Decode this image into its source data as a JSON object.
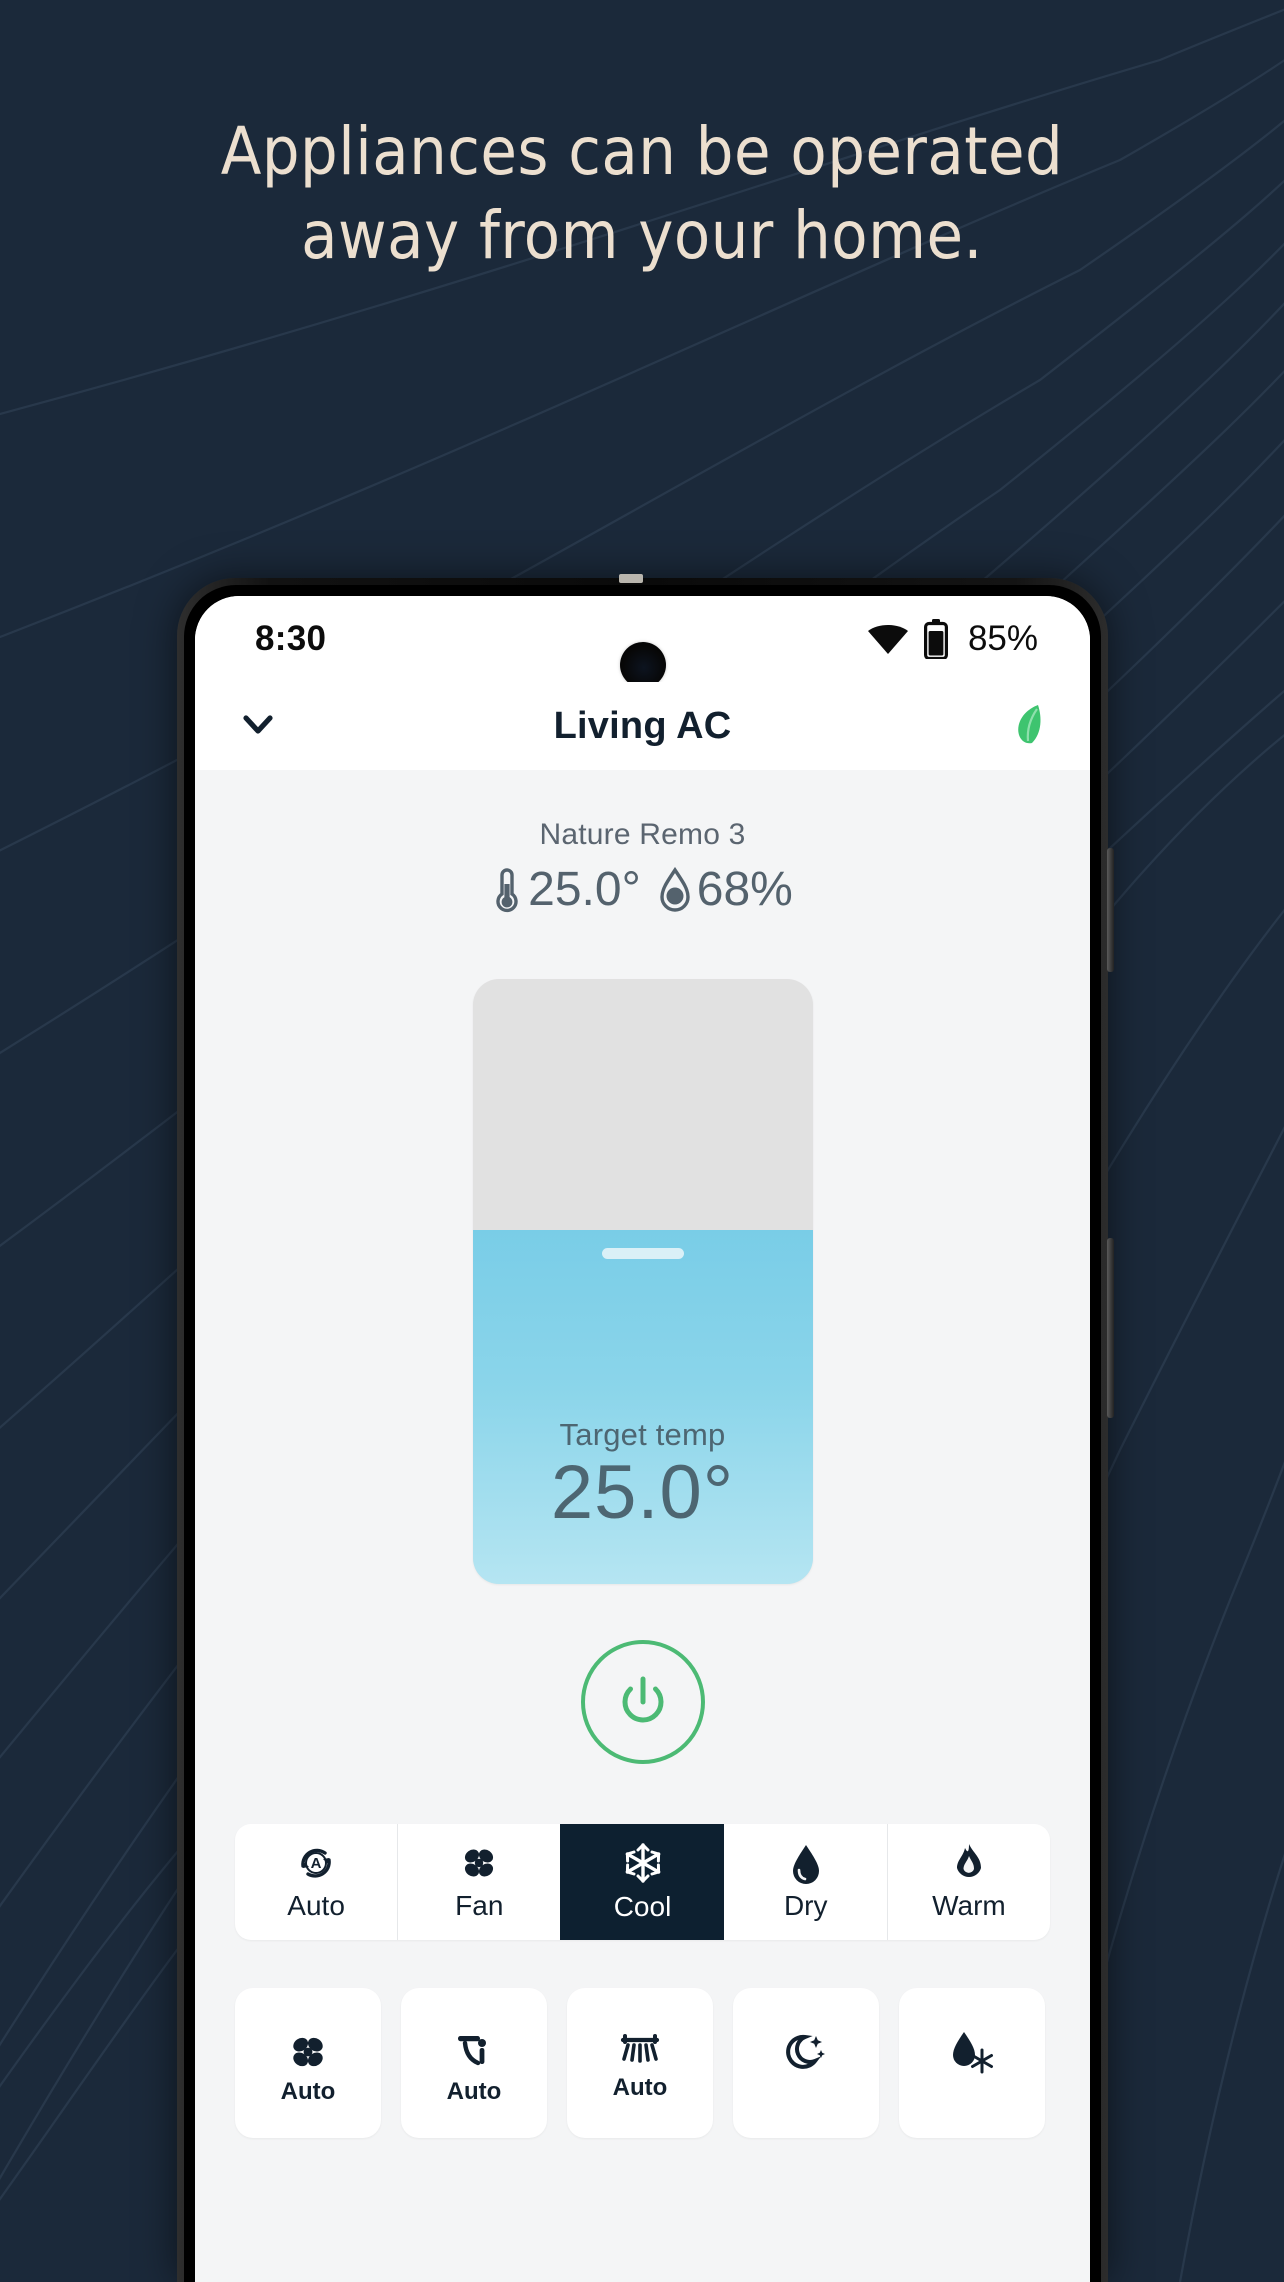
{
  "page": {
    "background_color": "#1b293a",
    "headline_color": "#ecdfcf",
    "headline_line1": "Appliances can be operated",
    "headline_line2": "away from your home."
  },
  "phone": {
    "statusbar": {
      "time": "8:30",
      "wifi_icon": "wifi-icon",
      "battery_icon": "battery-icon",
      "battery_percent": "85%",
      "camera_icon": "front-camera-punch-hole"
    },
    "header": {
      "back_icon": "chevron-down-icon",
      "title": "Living AC",
      "eco_icon": "leaf-icon",
      "eco_color": "#3ec46f"
    },
    "sensor": {
      "device_name": "Nature Remo 3",
      "temperature_icon": "thermometer-icon",
      "temperature": "25.0°",
      "humidity_icon": "humidity-droplet-icon",
      "humidity": "68%"
    },
    "temp_slider": {
      "label": "Target temp",
      "value": "25.0°",
      "fill_percent": 58.5,
      "track_color": "#e1e1e1",
      "fill_color": "#79cde7",
      "handle_icon": "slider-handle"
    },
    "power": {
      "icon": "power-icon",
      "color": "#4cba74"
    },
    "modes": [
      {
        "label": "Auto",
        "icon": "auto-mode-icon",
        "selected": false
      },
      {
        "label": "Fan",
        "icon": "fan-icon",
        "selected": false
      },
      {
        "label": "Cool",
        "icon": "snowflake-icon",
        "selected": true
      },
      {
        "label": "Dry",
        "icon": "droplet-icon",
        "selected": false
      },
      {
        "label": "Warm",
        "icon": "flame-icon",
        "selected": false
      }
    ],
    "options": [
      {
        "label": "Auto",
        "icon": "fan-speed-icon"
      },
      {
        "label": "Auto",
        "icon": "swing-vertical-icon"
      },
      {
        "label": "Auto",
        "icon": "swing-horizontal-icon"
      },
      {
        "label": "",
        "icon": "night-mode-icon"
      },
      {
        "label": "",
        "icon": "dehumidify-icon"
      }
    ]
  }
}
